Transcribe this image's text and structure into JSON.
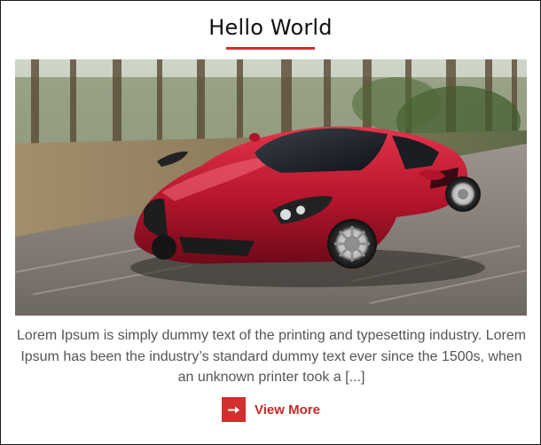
{
  "card": {
    "title": "Hello World",
    "image": {
      "alt": "Red sports car driving on a road through a forest"
    },
    "excerpt": "Lorem Ipsum is simply dummy text of the printing and typesetting industry. Lorem Ipsum has been the industry’s standard dummy text ever since the 1500s, when an unknown printer took a [...]",
    "read_more": {
      "label": "View More",
      "icon": "arrow-right-icon"
    }
  },
  "colors": {
    "accent": "#d22f2f",
    "link": "#c62828",
    "title": "#111111",
    "body_text": "#555555",
    "border": "#1a1a1a"
  }
}
